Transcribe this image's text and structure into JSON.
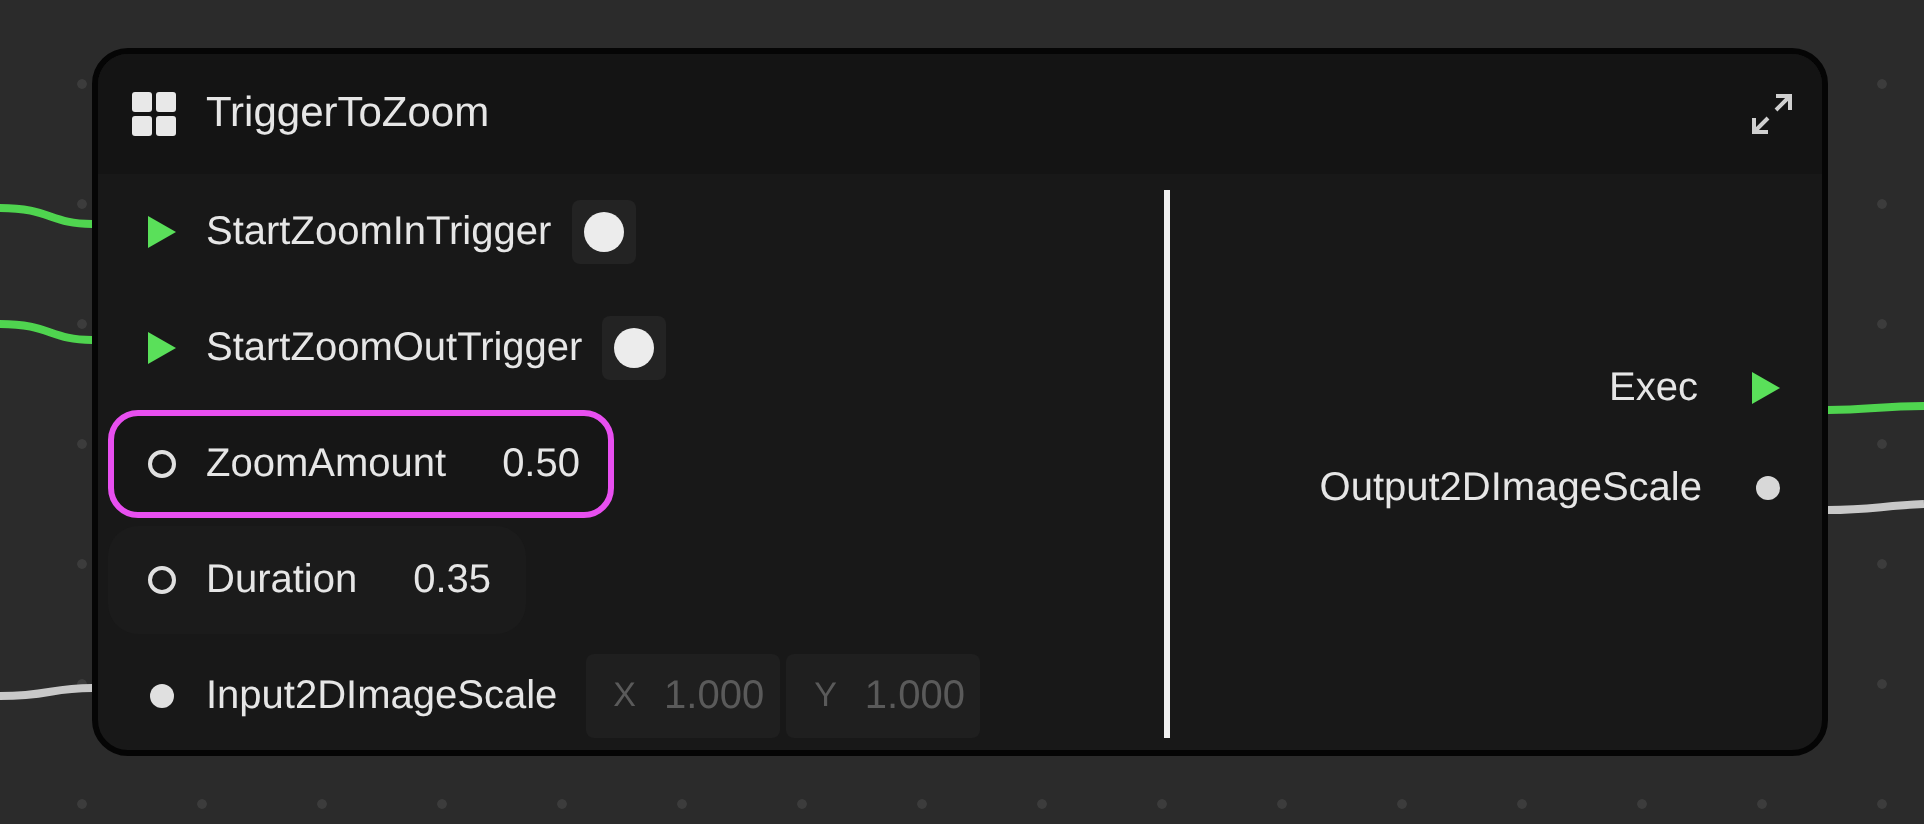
{
  "node": {
    "title": "TriggerToZoom",
    "inputs": [
      {
        "kind": "exec",
        "label": "StartZoomInTrigger",
        "connected": true,
        "selected": false
      },
      {
        "kind": "exec",
        "label": "StartZoomOutTrigger",
        "connected": true,
        "selected": false
      },
      {
        "kind": "float",
        "label": "ZoomAmount",
        "value": "0.50",
        "connected": false,
        "selected": true
      },
      {
        "kind": "float",
        "label": "Duration",
        "value": "0.35",
        "connected": false,
        "selected": false
      },
      {
        "kind": "vector",
        "label": "Input2DImageScale",
        "x_label": "X",
        "x_value": "1.000",
        "y_label": "Y",
        "y_value": "1.000",
        "connected": true,
        "selected": false
      }
    ],
    "outputs": [
      {
        "kind": "exec",
        "label": "Exec",
        "connected": true
      },
      {
        "kind": "vector",
        "label": "Output2DImageScale",
        "connected": true
      }
    ]
  }
}
